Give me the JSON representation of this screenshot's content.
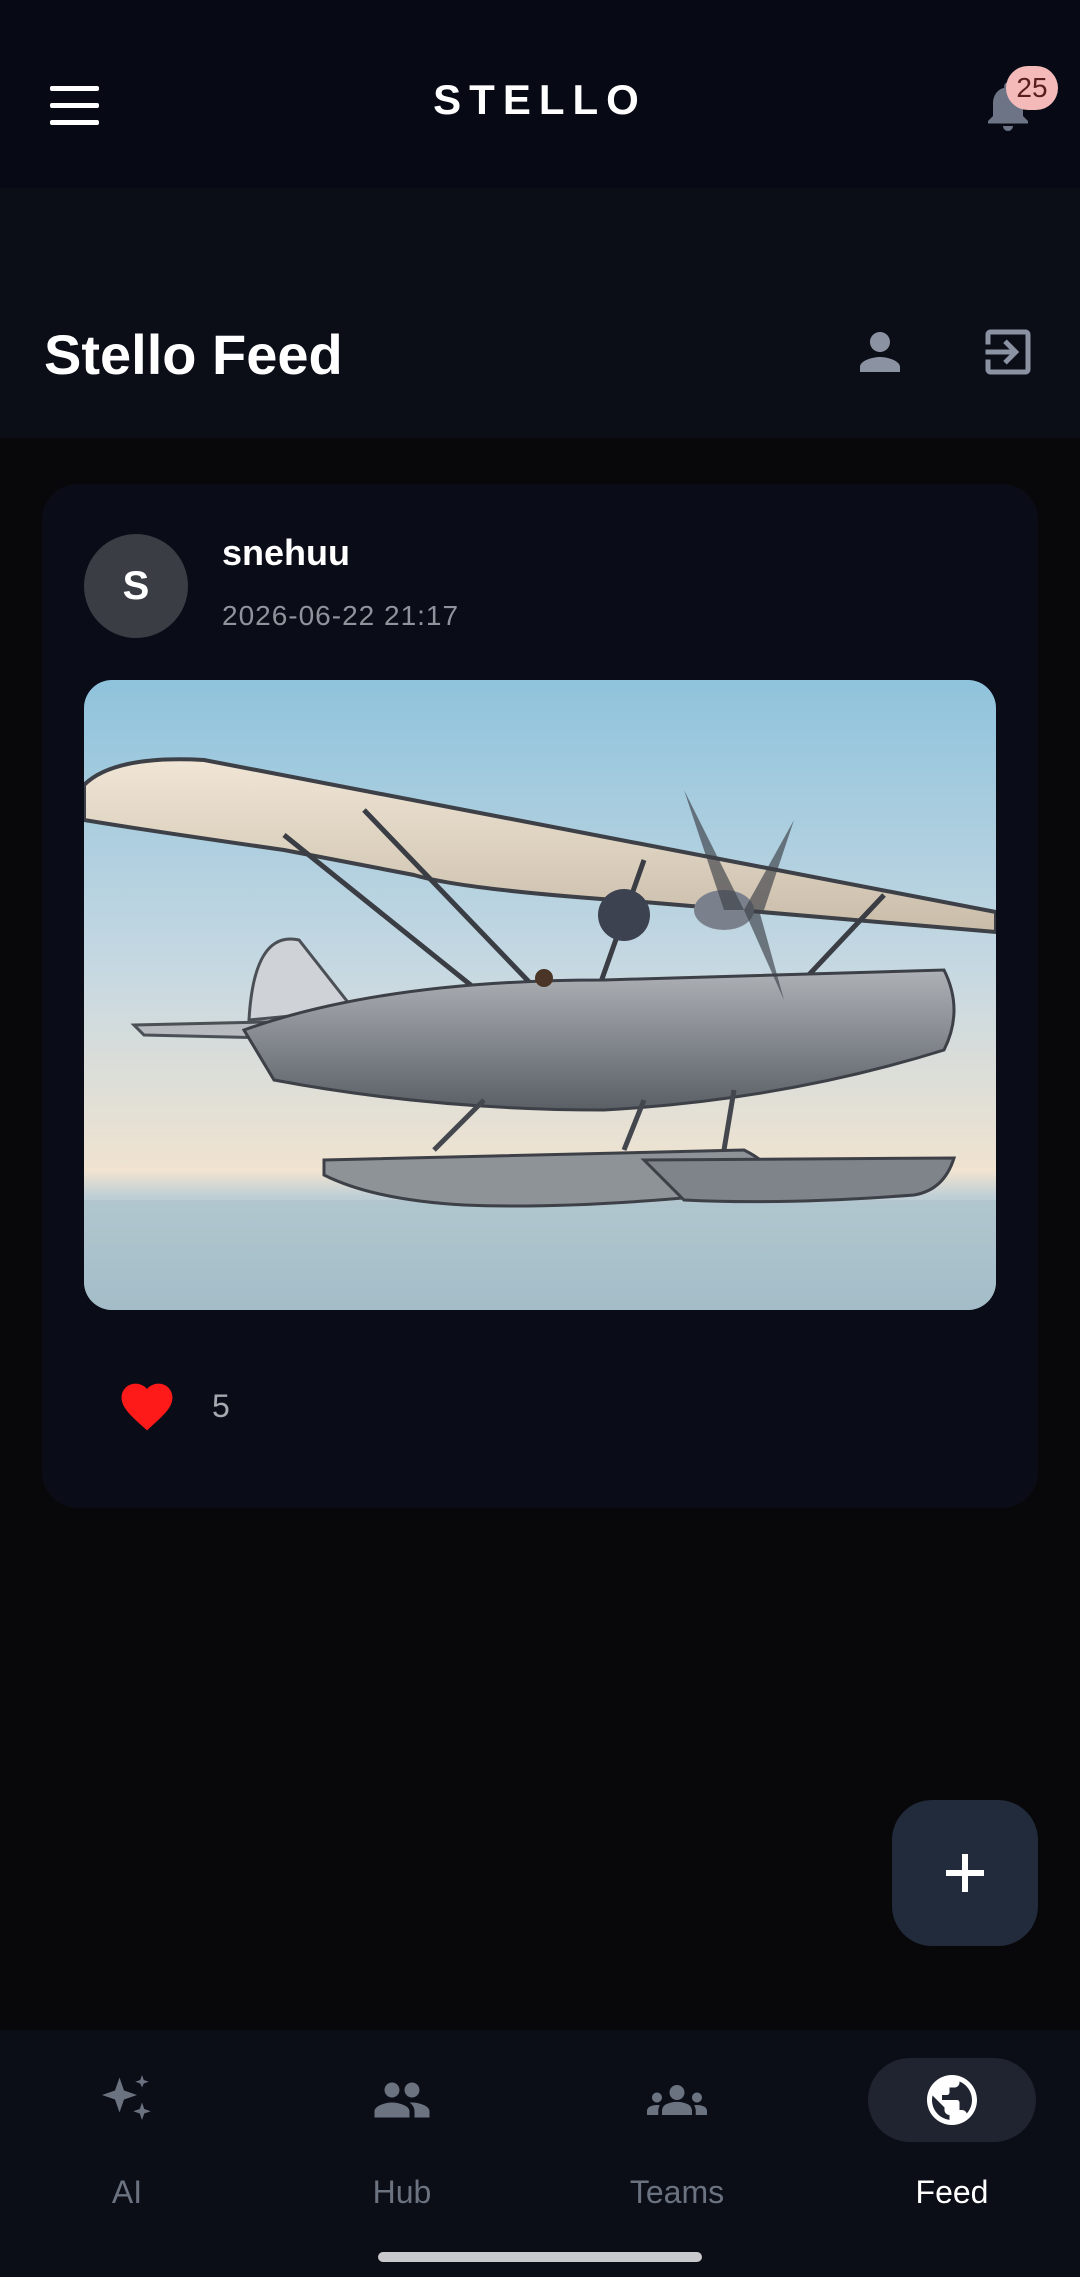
{
  "header": {
    "brand": "STELLO",
    "notification_count": "25"
  },
  "page": {
    "title": "Stello Feed"
  },
  "post": {
    "avatar_initial": "S",
    "author": "snehuu",
    "timestamp": "2026-06-22 21:17",
    "image_subject": "seaplane-illustration",
    "like_count": "5"
  },
  "nav": {
    "items": [
      {
        "label": "AI",
        "icon": "sparkle-icon"
      },
      {
        "label": "Hub",
        "icon": "people-icon"
      },
      {
        "label": "Teams",
        "icon": "groups-icon"
      },
      {
        "label": "Feed",
        "icon": "globe-icon",
        "active": true
      }
    ]
  },
  "colors": {
    "background": "#08080b",
    "card": "#0a0d17",
    "badge": "#f4b9b9",
    "heart": "#ff1a1a",
    "fab": "#222b3b",
    "nav_inactive": "#6b7280"
  }
}
